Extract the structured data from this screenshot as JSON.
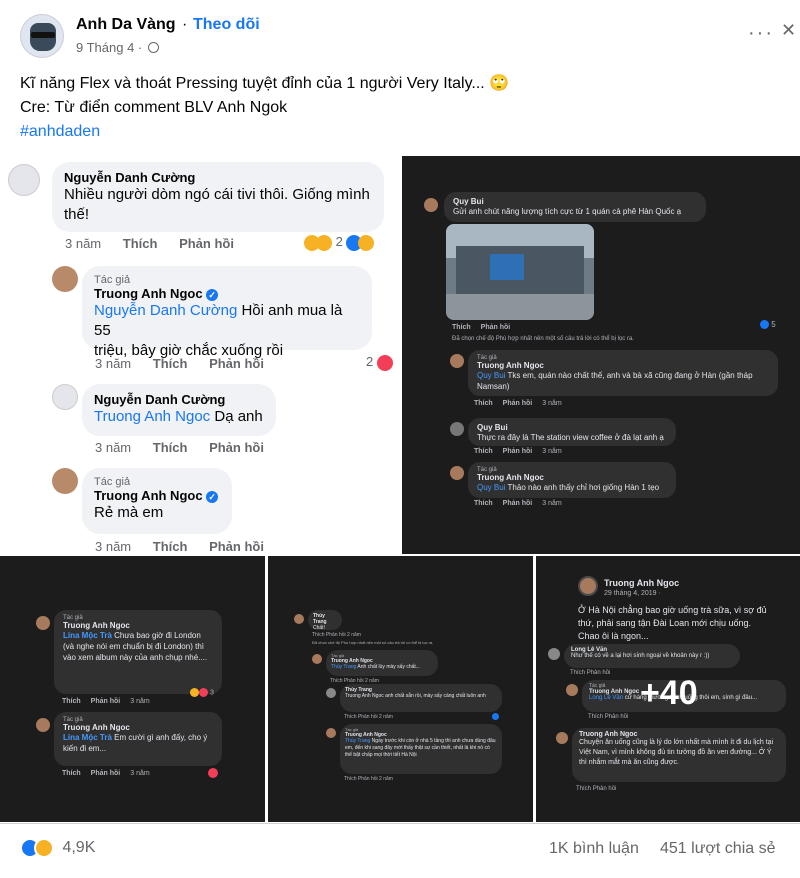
{
  "header": {
    "author": "Anh Da Vàng",
    "separator": "·",
    "follow": "Theo dõi",
    "date": "9 Tháng 4 ·",
    "privacy_icon": "globe-icon",
    "more_icon": "more-icon",
    "close": "✕"
  },
  "post": {
    "line1": "Kĩ năng Flex và thoát Pressing tuyệt đỉnh của 1 người Very Italy... 🙄",
    "line2": "Cre: Từ điển comment BLV Anh Ngok",
    "hashtag": "#anhdaden"
  },
  "panel1": {
    "c1": {
      "name": "Nguyễn Danh Cường",
      "text1": "Nhiều người dòm ngó cái tivi thôi. Giống mình",
      "text2": "thế!",
      "time": "3 năm",
      "like": "Thích",
      "reply": "Phản hồi",
      "count": "2"
    },
    "c2": {
      "tag": "Tác giả",
      "name": "Truong Anh Ngoc",
      "mention": "Nguyễn Danh Cường",
      "text1": " Hồi anh mua là 55",
      "text2": "triệu, bây giờ chắc xuống rồi",
      "time": "3 năm",
      "like": "Thích",
      "reply": "Phản hồi",
      "count": "2"
    },
    "c3": {
      "name": "Nguyễn Danh Cường",
      "mention": "Truong Anh Ngoc",
      "text": " Dạ anh",
      "time": "3 năm",
      "like": "Thích",
      "reply": "Phản hồi"
    },
    "c4": {
      "tag": "Tác giả",
      "name": "Truong Anh Ngoc",
      "text": "Rẻ mà em",
      "time": "3 năm",
      "like": "Thích",
      "reply": "Phản hồi"
    }
  },
  "panel2": {
    "c1": {
      "name": "Quy Bui",
      "text": "Gửi anh chút năng lượng tích cực từ 1 quán cà phê Hàn Quốc ạ",
      "like": "Thích",
      "reply": "Phản hồi",
      "count": "5"
    },
    "note": "Đã chọn chế độ Phù hợp nhất nên một số câu trả lời có thể bị lọc ra.",
    "c2": {
      "tag": "Tác giả",
      "name": "Truong Anh Ngoc",
      "mention": "Quy Bui",
      "text1": " Tks em, quán nào chất thế, anh và bà xã cũng đang ở Hàn (gần tháp",
      "text2": "Namsan)",
      "like": "Thích",
      "reply": "Phản hồi",
      "time": "3 năm"
    },
    "c3": {
      "name": "Quy Bui",
      "text": "Thực ra đây là The station view coffee ở đà lạt anh ạ",
      "like": "Thích",
      "reply": "Phản hồi",
      "time": "3 năm"
    },
    "c4": {
      "tag": "Tác giả",
      "name": "Truong Anh Ngoc",
      "mention": "Quy Bui",
      "text": " Thảo nào anh thấy chỉ hơi giống Hàn 1 tẹo",
      "like": "Thích",
      "reply": "Phản hồi",
      "time": "3 năm"
    }
  },
  "panel3": {
    "c1": {
      "tag": "Tác giả",
      "name": "Truong Anh Ngoc",
      "mention": "Lina Mộc Trà",
      "text": " Chưa bao giờ đi London (và nghe nói em chuẩn bị đi London) thì vào xem album này của anh chụp nhé....",
      "like": "Thích",
      "reply": "Phản hồi",
      "time": "3 năm",
      "count": "3"
    },
    "c2": {
      "tag": "Tác giả",
      "name": "Truong Anh Ngoc",
      "mention": "Lina Mộc Trà",
      "text": " Em cười gì anh đấy, cho ý kiến đi em...",
      "like": "Thích",
      "reply": "Phản hồi",
      "time": "3 năm"
    }
  },
  "panel4": {
    "c1": {
      "name": "Thùy Trang",
      "text": "Chất!",
      "like": "Thích",
      "reply": "Phản hồi",
      "time": "2 năm"
    },
    "note": "Đã chọn chế độ Phù hợp nhất nên một số câu trả lời có thể bị lọc ra.",
    "c2": {
      "tag": "Tác giả",
      "name": "Truong Anh Ngoc",
      "mention": "Thùy Trang",
      "text": " Anh chất lùy mày sấy chất...",
      "like": "Thích",
      "reply": "Phản hồi",
      "time": "2 năm"
    },
    "c3": {
      "name": "Thùy Trang",
      "text": "Truong Anh Ngoc anh chất sẵn rồi, mày sấy càng chất luôn anh",
      "like": "Thích",
      "reply": "Phản hồi",
      "time": "2 năm"
    },
    "c4": {
      "tag": "Tác giả",
      "name": "Truong Anh Ngoc",
      "mention": "Thùy Trang",
      "text": " Ngày trước khi còn ở nhà 5 tầng thì anh chưa dùng đâu em, đến khi sang đây mới thấy thật sự cần thiết, nhất là khi nó có thể bật chấp mọi thời tiết Hà Nội",
      "like": "Thích",
      "reply": "Phản hồi",
      "time": "2 năm"
    }
  },
  "panel5": {
    "author": "Truong Anh Ngoc",
    "date": "29 tháng 4, 2019 ·",
    "text": "Ở Hà Nội chẳng bao giờ uống trà sữa, vì sợ đủ thứ, phải sang tận Đài Loan mới chịu uống. Chao ôi là ngon...",
    "c1": {
      "name": "Long Lê Văn",
      "text": "Như thế có về a lại hơi sính ngoại về khoản này r :))",
      "like": "Thích",
      "reply": "Phản hồi"
    },
    "c2": {
      "tag": "Tác giả",
      "name": "Truong Anh Ngoc",
      "mention": "Long Lê Văn",
      "text": " cứ hàng thương thích uống thôi em, sính gì đâu...",
      "like": "Thích",
      "reply": "Phản hồi"
    },
    "c3": {
      "name": "Truong Anh Ngoc",
      "text": "Chuyện ăn uống cũng là lý do lớn nhất mà mình ít đi du lịch tại Việt Nam, vì mình không đủ tin tưởng đồ ăn ven đường... Ở Ý thì nhắm mắt mà ăn cũng được.",
      "like": "Thích",
      "reply": "Phản hồi"
    },
    "more": "+40"
  },
  "footer": {
    "reactions": "4,9K",
    "comments": "1K bình luận",
    "shares": "451 lượt chia sẻ"
  },
  "colors": {
    "accent": "#1877f2",
    "dark_bg": "#1c1c1d",
    "bubble_dark": "#303031"
  }
}
